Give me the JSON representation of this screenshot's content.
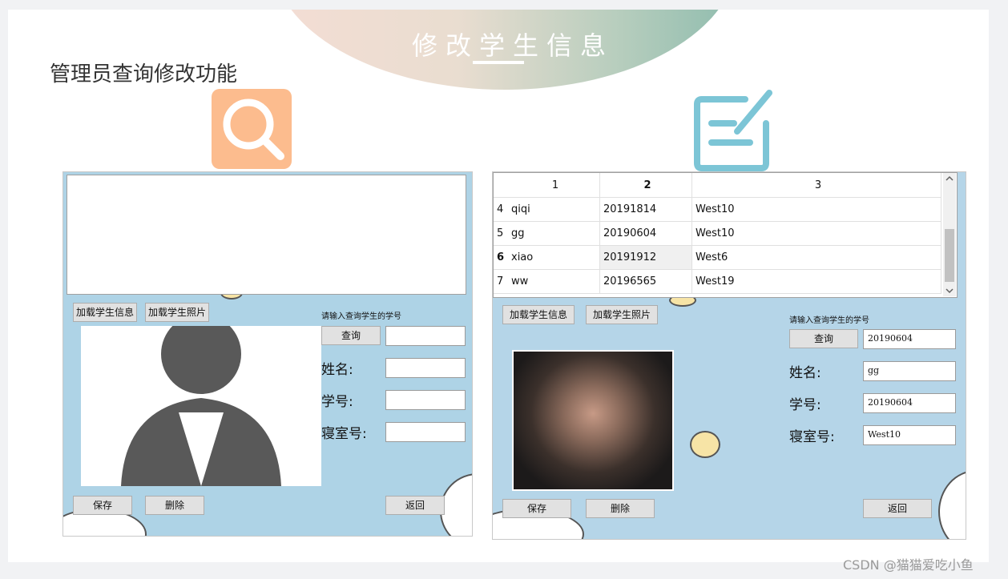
{
  "banner_title": "修改学生信息",
  "heading": "管理员查询修改功能",
  "watermark": "CSDN @猫猫爱吃小鱼",
  "left_window": {
    "load_info": "加载学生信息",
    "load_photo": "加载学生照片",
    "prompt": "请输入查询学生的学号",
    "query": "查询",
    "query_value": "",
    "name_label": "姓名:",
    "name_value": "",
    "id_label": "学号:",
    "id_value": "",
    "dorm_label": "寝室号:",
    "dorm_value": "",
    "save": "保存",
    "delete": "删除",
    "back": "返回"
  },
  "right_window": {
    "columns": [
      "1",
      "2",
      "3"
    ],
    "rows": [
      {
        "num": "4",
        "name": "qiqi",
        "id": "20191814",
        "dorm": "West10"
      },
      {
        "num": "5",
        "name": "gg",
        "id": "20190604",
        "dorm": "West10"
      },
      {
        "num": "6",
        "name": "xiao",
        "id": "20191912",
        "dorm": "West6"
      },
      {
        "num": "7",
        "name": "ww",
        "id": "20196565",
        "dorm": "West19"
      }
    ],
    "load_info": "加载学生信息",
    "load_photo": "加载学生照片",
    "prompt": "请输入查询学生的学号",
    "query": "查询",
    "query_value": "20190604",
    "name_label": "姓名:",
    "name_value": "gg",
    "id_label": "学号:",
    "id_value": "20190604",
    "dorm_label": "寝室号:",
    "dorm_value": "West10",
    "save": "保存",
    "delete": "删除",
    "back": "返回"
  }
}
